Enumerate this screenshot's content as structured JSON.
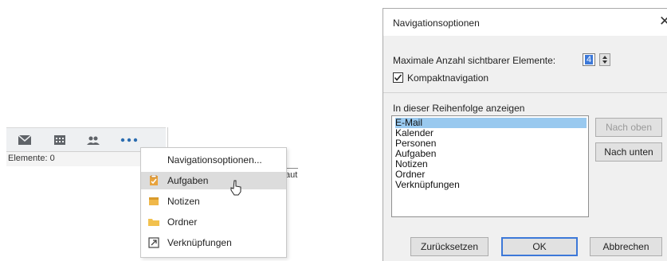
{
  "outlook": {
    "status": "Elemente: 0",
    "right_fragment": "aut",
    "nav_icons": [
      "mail-icon",
      "calendar-icon",
      "people-icon",
      "more-icon"
    ]
  },
  "context_menu": {
    "items": [
      {
        "label": "Navigationsoptionen...",
        "icon": ""
      },
      {
        "label": "Aufgaben",
        "icon": "tasks-icon"
      },
      {
        "label": "Notizen",
        "icon": "notes-icon"
      },
      {
        "label": "Ordner",
        "icon": "folder-icon"
      },
      {
        "label": "Verknüpfungen",
        "icon": "shortcuts-icon"
      }
    ],
    "highlighted_index": 1
  },
  "dialog": {
    "title": "Navigationsoptionen",
    "max_label": "Maximale Anzahl sichtbarer Elemente:",
    "max_value": "4",
    "compact_label": "Kompaktnavigation",
    "compact_checked": true,
    "order_label": "In dieser Reihenfolge anzeigen",
    "list": [
      "E-Mail",
      "Kalender",
      "Personen",
      "Aufgaben",
      "Notizen",
      "Ordner",
      "Verknüpfungen"
    ],
    "selected_index": 0,
    "btn_up": "Nach oben",
    "btn_down": "Nach unten",
    "btn_reset": "Zurücksetzen",
    "btn_ok": "OK",
    "btn_cancel": "Abbrechen"
  },
  "colors": {
    "accent": "#3c78d8",
    "selection": "#99c9ef",
    "menu_highlight": "#dcdcdc"
  }
}
